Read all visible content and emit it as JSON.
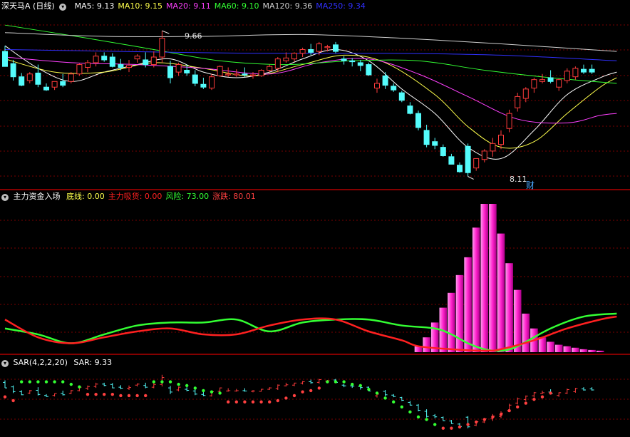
{
  "colors": {
    "bg": "#000000",
    "up": "#ff3c3c",
    "down": "#54fcfc",
    "grid": "#7a0000",
    "sep": "#b00000",
    "ma5": "#ffffff",
    "ma10": "#ffff4c",
    "ma20": "#ff40ff",
    "ma60": "#33ff33",
    "ma120": "#d0d0d0",
    "ma250": "#3030ff",
    "magenta": "#ff33cc",
    "green": "#33ff33",
    "red": "#ff2020",
    "sar_up": "#ff4040",
    "sar_dn": "#33ff33"
  },
  "panel1": {
    "title": "深天马A (日线)",
    "legend": [
      {
        "label": "MA5:",
        "value": "9.13",
        "color": "#ffffff"
      },
      {
        "label": "MA10:",
        "value": "9.15",
        "color": "#ffff4c"
      },
      {
        "label": "MA20:",
        "value": "9.11",
        "color": "#ff40ff"
      },
      {
        "label": "MA60:",
        "value": "9.10",
        "color": "#33ff33"
      },
      {
        "label": "MA120:",
        "value": "9.36",
        "color": "#d0d0d0"
      },
      {
        "label": "MA250:",
        "value": "9.34",
        "color": "#3030ff"
      }
    ],
    "high_label": "9.66",
    "low_label": "8.11",
    "cai_label": "财"
  },
  "panel2": {
    "title": "主力资金入场",
    "legend": [
      {
        "label": "底线:",
        "value": "0.00",
        "color": "#ffff4c"
      },
      {
        "label": "主力吸货:",
        "value": "0.00",
        "color": "#ff2020"
      },
      {
        "label": "风险:",
        "value": "73.00",
        "color": "#33ff33"
      },
      {
        "label": "涨跌:",
        "value": "80.01",
        "color": "#ff4040"
      }
    ]
  },
  "panel3": {
    "title": "SAR(4,2,2,20)",
    "legend": [
      {
        "label": "SAR:",
        "value": "9.33",
        "color": "#ffffff"
      }
    ]
  },
  "chart_data": {
    "type": "candlestick",
    "price_range": [
      8.0,
      9.82
    ],
    "candles": [
      [
        9.44,
        9.5,
        9.28,
        9.28
      ],
      [
        9.31,
        9.35,
        9.13,
        9.17
      ],
      [
        9.17,
        9.21,
        9.07,
        9.08
      ],
      [
        9.13,
        9.22,
        9.1,
        9.2
      ],
      [
        9.21,
        9.3,
        9.06,
        9.09
      ],
      [
        9.06,
        9.1,
        9.02,
        9.03
      ],
      [
        9.06,
        9.12,
        9.03,
        9.12
      ],
      [
        9.12,
        9.2,
        9.06,
        9.08
      ],
      [
        9.12,
        9.22,
        9.1,
        9.2
      ],
      [
        9.2,
        9.31,
        9.18,
        9.3
      ],
      [
        9.27,
        9.35,
        9.22,
        9.32
      ],
      [
        9.32,
        9.43,
        9.28,
        9.39
      ],
      [
        9.39,
        9.43,
        9.33,
        9.35
      ],
      [
        9.38,
        9.42,
        9.27,
        9.28
      ],
      [
        9.3,
        9.36,
        9.24,
        9.27
      ],
      [
        9.27,
        9.35,
        9.22,
        9.29
      ],
      [
        9.36,
        9.41,
        9.32,
        9.39
      ],
      [
        9.35,
        9.43,
        9.27,
        9.3
      ],
      [
        9.3,
        9.44,
        9.27,
        9.38
      ],
      [
        9.38,
        9.66,
        9.32,
        9.58
      ],
      [
        9.28,
        9.34,
        9.1,
        9.16
      ],
      [
        9.22,
        9.32,
        9.18,
        9.3
      ],
      [
        9.24,
        9.3,
        9.18,
        9.21
      ],
      [
        9.19,
        9.24,
        9.07,
        9.1
      ],
      [
        9.09,
        9.16,
        9.04,
        9.06
      ],
      [
        9.05,
        9.2,
        9.03,
        9.17
      ],
      [
        9.18,
        9.29,
        9.17,
        9.28
      ],
      [
        9.19,
        9.27,
        9.17,
        9.2
      ],
      [
        9.19,
        9.25,
        9.17,
        9.2
      ],
      [
        9.2,
        9.27,
        9.17,
        9.19
      ],
      [
        9.18,
        9.22,
        9.15,
        9.19
      ],
      [
        9.18,
        9.25,
        9.17,
        9.24
      ],
      [
        9.24,
        9.3,
        9.22,
        9.28
      ],
      [
        9.26,
        9.38,
        9.22,
        9.36
      ],
      [
        9.34,
        9.43,
        9.32,
        9.37
      ],
      [
        9.36,
        9.43,
        9.33,
        9.42
      ],
      [
        9.42,
        9.48,
        9.38,
        9.46
      ],
      [
        9.46,
        9.52,
        9.4,
        9.43
      ],
      [
        9.44,
        9.54,
        9.4,
        9.52
      ],
      [
        9.48,
        9.51,
        9.44,
        9.49
      ],
      [
        9.51,
        9.54,
        9.42,
        9.44
      ],
      [
        9.36,
        9.39,
        9.3,
        9.34
      ],
      [
        9.34,
        9.37,
        9.28,
        9.33
      ],
      [
        9.32,
        9.35,
        9.23,
        9.29
      ],
      [
        9.3,
        9.32,
        9.18,
        9.19
      ],
      [
        9.05,
        9.15,
        9.0,
        9.1
      ],
      [
        9.18,
        9.22,
        9.04,
        9.08
      ],
      [
        9.07,
        9.1,
        9.01,
        9.03
      ],
      [
        9.0,
        9.02,
        8.9,
        8.92
      ],
      [
        8.86,
        8.9,
        8.77,
        8.78
      ],
      [
        8.78,
        8.81,
        8.6,
        8.63
      ],
      [
        8.6,
        8.66,
        8.42,
        8.45
      ],
      [
        8.48,
        8.52,
        8.4,
        8.44
      ],
      [
        8.42,
        8.45,
        8.32,
        8.33
      ],
      [
        8.32,
        8.35,
        8.24,
        8.24
      ],
      [
        8.23,
        8.26,
        8.15,
        8.16
      ],
      [
        8.43,
        8.46,
        8.11,
        8.15
      ],
      [
        8.2,
        8.3,
        8.17,
        8.3
      ],
      [
        8.29,
        8.4,
        8.26,
        8.38
      ],
      [
        8.38,
        8.52,
        8.32,
        8.46
      ],
      [
        8.45,
        8.6,
        8.4,
        8.55
      ],
      [
        8.62,
        8.82,
        8.58,
        8.78
      ],
      [
        8.84,
        9.0,
        8.8,
        8.96
      ],
      [
        8.94,
        9.06,
        8.9,
        9.04
      ],
      [
        9.05,
        9.16,
        9.0,
        9.14
      ],
      [
        9.12,
        9.2,
        9.1,
        9.14
      ],
      [
        9.16,
        9.24,
        9.1,
        9.12
      ],
      [
        9.06,
        9.15,
        9.02,
        9.14
      ],
      [
        9.13,
        9.26,
        9.1,
        9.23
      ],
      [
        9.17,
        9.28,
        9.14,
        9.26
      ],
      [
        9.25,
        9.3,
        9.2,
        9.22
      ],
      [
        9.25,
        9.3,
        9.2,
        9.22
      ]
    ],
    "ma": {
      "ma5": [
        [
          0,
          9.5
        ],
        [
          4,
          9.26
        ],
        [
          8,
          9.12
        ],
        [
          12,
          9.22
        ],
        [
          16,
          9.3
        ],
        [
          20,
          9.36
        ],
        [
          24,
          9.22
        ],
        [
          28,
          9.16
        ],
        [
          32,
          9.22
        ],
        [
          36,
          9.36
        ],
        [
          40,
          9.46
        ],
        [
          44,
          9.34
        ],
        [
          48,
          9.04
        ],
        [
          52,
          8.78
        ],
        [
          56,
          8.42
        ],
        [
          60,
          8.3
        ],
        [
          64,
          8.6
        ],
        [
          68,
          8.98
        ],
        [
          72,
          9.16
        ],
        [
          74,
          9.22
        ]
      ],
      "ma10": [
        [
          0,
          9.36
        ],
        [
          6,
          9.22
        ],
        [
          12,
          9.22
        ],
        [
          18,
          9.32
        ],
        [
          24,
          9.26
        ],
        [
          30,
          9.18
        ],
        [
          36,
          9.3
        ],
        [
          41,
          9.4
        ],
        [
          46,
          9.32
        ],
        [
          52,
          8.98
        ],
        [
          56,
          8.64
        ],
        [
          60,
          8.42
        ],
        [
          64,
          8.48
        ],
        [
          68,
          8.78
        ],
        [
          72,
          9.06
        ],
        [
          74,
          9.16
        ]
      ],
      "ma20": [
        [
          0,
          9.38
        ],
        [
          8,
          9.32
        ],
        [
          16,
          9.3
        ],
        [
          24,
          9.26
        ],
        [
          32,
          9.2
        ],
        [
          38,
          9.32
        ],
        [
          44,
          9.36
        ],
        [
          50,
          9.2
        ],
        [
          56,
          8.96
        ],
        [
          62,
          8.72
        ],
        [
          68,
          8.68
        ],
        [
          72,
          8.76
        ],
        [
          74,
          8.78
        ]
      ],
      "ma60": [
        [
          0,
          9.72
        ],
        [
          10,
          9.58
        ],
        [
          18,
          9.46
        ],
        [
          26,
          9.34
        ],
        [
          34,
          9.3
        ],
        [
          42,
          9.34
        ],
        [
          50,
          9.34
        ],
        [
          58,
          9.24
        ],
        [
          66,
          9.16
        ],
        [
          74,
          9.1
        ]
      ],
      "ma120": [
        [
          0,
          9.64
        ],
        [
          12,
          9.6
        ],
        [
          24,
          9.6
        ],
        [
          36,
          9.62
        ],
        [
          48,
          9.58
        ],
        [
          60,
          9.52
        ],
        [
          74,
          9.44
        ]
      ],
      "ma250": [
        [
          0,
          9.46
        ],
        [
          14,
          9.44
        ],
        [
          30,
          9.42
        ],
        [
          46,
          9.42
        ],
        [
          60,
          9.4
        ],
        [
          74,
          9.34
        ]
      ]
    },
    "panel2_range": [
      0,
      100
    ],
    "bars": [
      [
        50,
        4
      ],
      [
        51,
        10
      ],
      [
        52,
        20
      ],
      [
        53,
        30
      ],
      [
        54,
        40
      ],
      [
        55,
        52
      ],
      [
        56,
        64
      ],
      [
        57,
        84
      ],
      [
        58,
        100
      ],
      [
        59,
        100
      ],
      [
        60,
        80
      ],
      [
        61,
        60
      ],
      [
        62,
        42
      ],
      [
        63,
        26
      ],
      [
        64,
        16
      ],
      [
        65,
        10
      ],
      [
        66,
        7
      ],
      [
        67,
        5
      ],
      [
        68,
        4
      ],
      [
        69,
        3
      ],
      [
        70,
        2
      ],
      [
        71,
        1.5
      ],
      [
        72,
        1
      ]
    ],
    "green_line": [
      [
        0,
        16
      ],
      [
        4,
        12
      ],
      [
        8,
        6
      ],
      [
        12,
        12
      ],
      [
        16,
        18
      ],
      [
        20,
        20
      ],
      [
        24,
        20
      ],
      [
        28,
        22
      ],
      [
        32,
        14
      ],
      [
        36,
        20
      ],
      [
        40,
        22
      ],
      [
        44,
        22
      ],
      [
        48,
        18
      ],
      [
        52,
        16
      ],
      [
        54,
        12
      ],
      [
        56,
        6
      ],
      [
        58,
        2
      ],
      [
        60,
        1
      ],
      [
        62,
        4
      ],
      [
        66,
        16
      ],
      [
        70,
        24
      ],
      [
        74,
        26
      ]
    ],
    "red_line": [
      [
        0,
        22
      ],
      [
        4,
        10
      ],
      [
        8,
        6
      ],
      [
        12,
        10
      ],
      [
        16,
        14
      ],
      [
        20,
        16
      ],
      [
        24,
        12
      ],
      [
        28,
        12
      ],
      [
        32,
        18
      ],
      [
        36,
        22
      ],
      [
        40,
        22
      ],
      [
        44,
        14
      ],
      [
        48,
        8
      ],
      [
        50,
        4
      ],
      [
        54,
        2
      ],
      [
        58,
        1
      ],
      [
        60,
        2
      ],
      [
        64,
        8
      ],
      [
        68,
        16
      ],
      [
        72,
        22
      ],
      [
        74,
        24
      ]
    ],
    "sar_range": [
      0,
      100
    ],
    "sar_points": [
      [
        0,
        56,
        "r"
      ],
      [
        1,
        50,
        "r"
      ],
      [
        2,
        80,
        "g"
      ],
      [
        3,
        80,
        "g"
      ],
      [
        4,
        80,
        "g"
      ],
      [
        5,
        80,
        "g"
      ],
      [
        6,
        80,
        "g"
      ],
      [
        7,
        80,
        "g"
      ],
      [
        8,
        76,
        "g"
      ],
      [
        9,
        72,
        "g"
      ],
      [
        10,
        60,
        "r"
      ],
      [
        11,
        60,
        "r"
      ],
      [
        12,
        60,
        "r"
      ],
      [
        13,
        60,
        "r"
      ],
      [
        14,
        58,
        "r"
      ],
      [
        15,
        58,
        "r"
      ],
      [
        16,
        58,
        "r"
      ],
      [
        17,
        58,
        "r"
      ],
      [
        18,
        80,
        "g"
      ],
      [
        19,
        80,
        "g"
      ],
      [
        20,
        80,
        "g"
      ],
      [
        21,
        76,
        "g"
      ],
      [
        22,
        74,
        "g"
      ],
      [
        23,
        70,
        "g"
      ],
      [
        24,
        66,
        "g"
      ],
      [
        25,
        64,
        "g"
      ],
      [
        26,
        62,
        "g"
      ],
      [
        27,
        48,
        "r"
      ],
      [
        28,
        48,
        "r"
      ],
      [
        29,
        48,
        "r"
      ],
      [
        30,
        48,
        "r"
      ],
      [
        31,
        48,
        "r"
      ],
      [
        32,
        48,
        "r"
      ],
      [
        33,
        50,
        "r"
      ],
      [
        34,
        54,
        "r"
      ],
      [
        35,
        58,
        "r"
      ],
      [
        36,
        64,
        "r"
      ],
      [
        37,
        66,
        "r"
      ],
      [
        38,
        70,
        "r"
      ],
      [
        39,
        80,
        "g"
      ],
      [
        40,
        80,
        "g"
      ],
      [
        41,
        80,
        "g"
      ],
      [
        42,
        76,
        "g"
      ],
      [
        43,
        74,
        "g"
      ],
      [
        44,
        68,
        "g"
      ],
      [
        45,
        62,
        "g"
      ],
      [
        46,
        54,
        "g"
      ],
      [
        47,
        48,
        "g"
      ],
      [
        48,
        40,
        "g"
      ],
      [
        49,
        32,
        "g"
      ],
      [
        50,
        24,
        "g"
      ],
      [
        51,
        20,
        "g"
      ],
      [
        52,
        12,
        "g"
      ],
      [
        53,
        6,
        "r"
      ],
      [
        54,
        6,
        "r"
      ],
      [
        55,
        8,
        "r"
      ],
      [
        56,
        12,
        "r"
      ],
      [
        57,
        16,
        "r"
      ],
      [
        58,
        20,
        "r"
      ],
      [
        59,
        24,
        "r"
      ],
      [
        60,
        28,
        "r"
      ],
      [
        61,
        34,
        "r"
      ],
      [
        62,
        40,
        "r"
      ],
      [
        63,
        46,
        "r"
      ],
      [
        64,
        52,
        "r"
      ],
      [
        65,
        56,
        "r"
      ],
      [
        66,
        62,
        "r"
      ]
    ]
  }
}
